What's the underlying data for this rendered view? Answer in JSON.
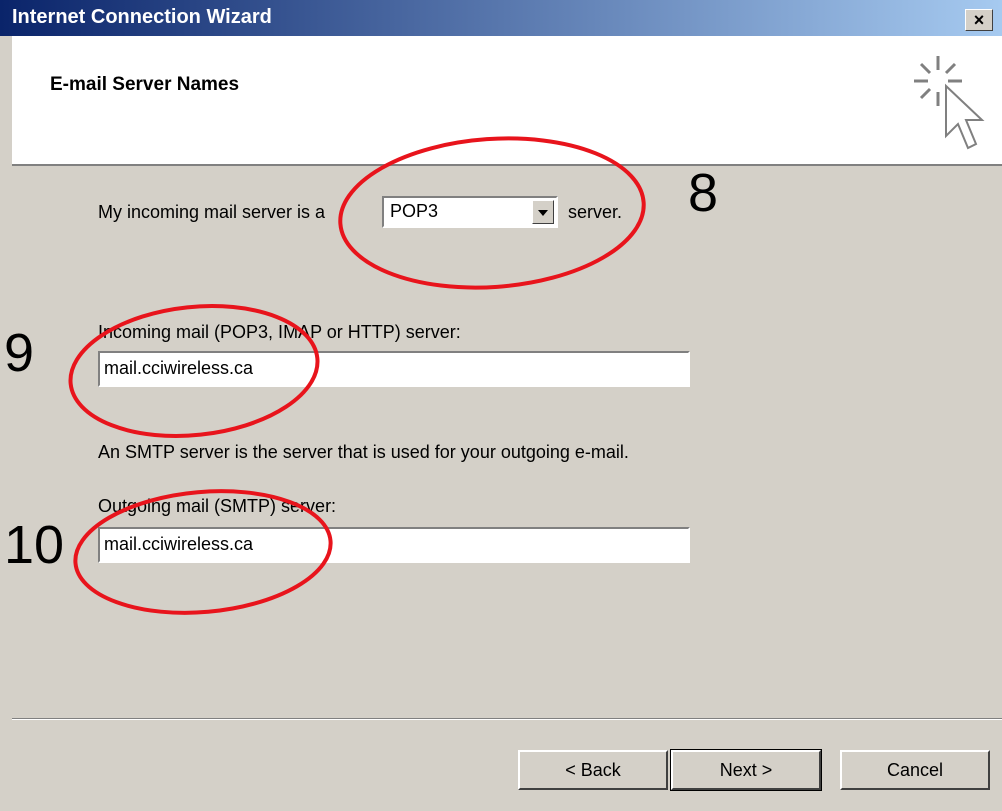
{
  "window": {
    "title": "Internet Connection Wizard",
    "close_glyph": "×"
  },
  "header": {
    "heading": "E-mail Server Names",
    "icon": "wizard-cursor-icon"
  },
  "incoming_type": {
    "prefix": "My incoming mail server is a",
    "value": "POP3",
    "suffix": "server."
  },
  "incoming": {
    "label": "Incoming mail (POP3, IMAP or HTTP) server:",
    "value": "mail.cciwireless.ca"
  },
  "smtp_note": "An SMTP server is the server that is used for your outgoing e-mail.",
  "outgoing": {
    "label": "Outgoing mail (SMTP) server:",
    "value": "mail.cciwireless.ca"
  },
  "buttons": {
    "back": "< Back",
    "next": "Next >",
    "cancel": "Cancel"
  },
  "annotations": {
    "step8": "8",
    "step9": "9",
    "step10": "10",
    "color": "#e8141c"
  }
}
